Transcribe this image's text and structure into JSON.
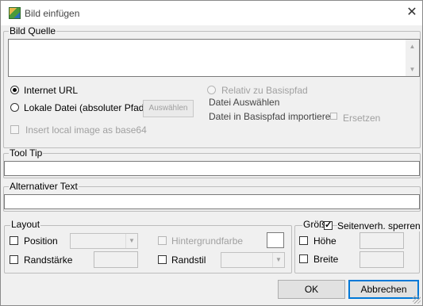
{
  "window": {
    "title": "Bild einfügen"
  },
  "source": {
    "legend": "Bild Quelle",
    "internet_url": "Internet URL",
    "local_file": "Lokale Datei (absoluter Pfad)",
    "browse_button": "Auswählen",
    "insert_base64": "Insert local image as base64",
    "relative_base": "Relativ zu Basispfad",
    "choose_file": "Datei Auswählen",
    "import_base": "Datei in Basispfad importieren",
    "replace": "Ersetzen"
  },
  "tooltip": {
    "legend": "Tool Tip",
    "value": ""
  },
  "alt_text": {
    "legend": "Alternativer Text",
    "value": ""
  },
  "layout": {
    "legend": "Layout",
    "position": "Position",
    "background": "Hintergrundfarbe",
    "border_width": "Randstärke",
    "border_style": "Randstil"
  },
  "size": {
    "legend": "Größ",
    "lock_ratio": "Seitenverh. sperren",
    "height": "Höhe",
    "width": "Breite"
  },
  "buttons": {
    "ok": "OK",
    "cancel": "Abbrechen"
  }
}
